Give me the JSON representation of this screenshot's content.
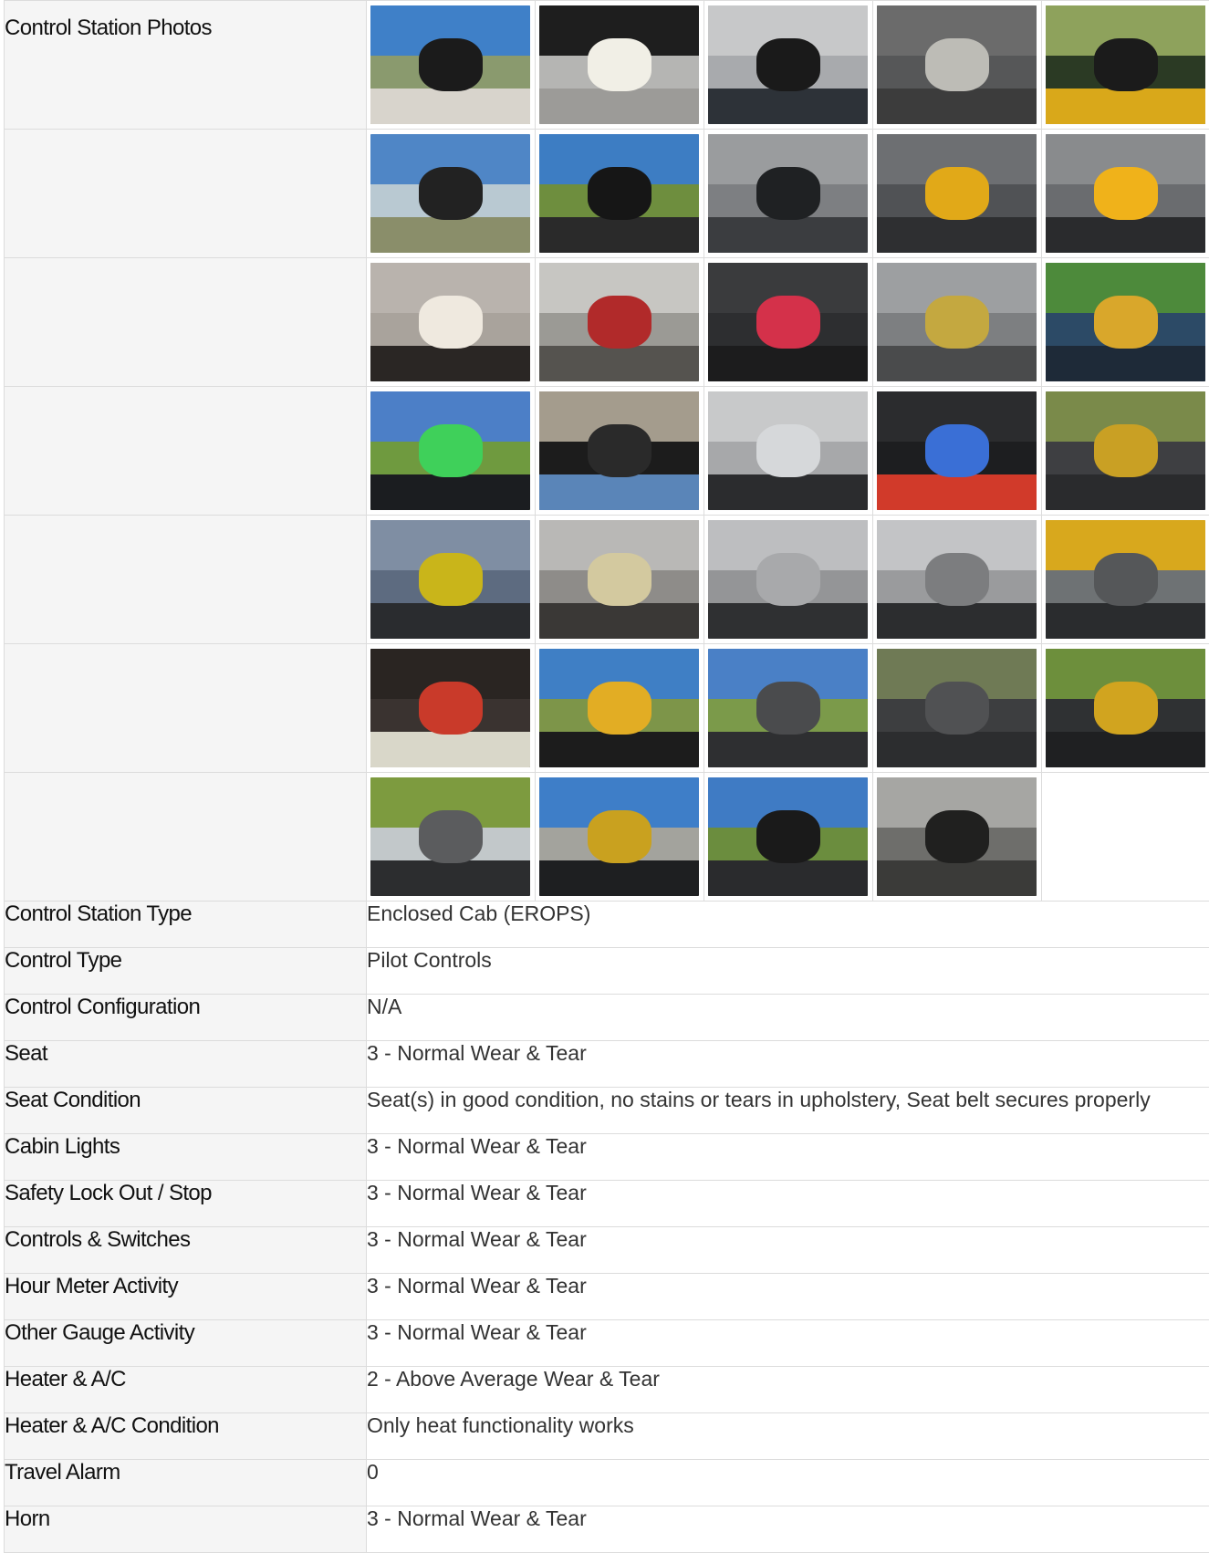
{
  "photos_label": "Control Station Photos",
  "photo_rows": [
    {
      "photos": [
        {
          "name": "photo-door-sticker",
          "c": [
            "#3f80c8",
            "#8a9a6e",
            "#d8d4cc",
            "#1b1b1b"
          ]
        },
        {
          "name": "photo-cab-ceiling-light",
          "c": [
            "#1e1e1e",
            "#b5b5b3",
            "#9c9b98",
            "#f1efe6"
          ]
        },
        {
          "name": "photo-ceiling-vent",
          "c": [
            "#c7c8c9",
            "#a8aaad",
            "#2d3238",
            "#1a1a1a"
          ]
        },
        {
          "name": "photo-ignition-knob",
          "c": [
            "#6b6b6b",
            "#565758",
            "#3c3c3c",
            "#bdbcb6"
          ]
        },
        {
          "name": "photo-engine-hood-view",
          "c": [
            "#8ea25c",
            "#2b3a24",
            "#d9a81a",
            "#1b1b1b"
          ]
        }
      ]
    },
    {
      "photos": [
        {
          "name": "photo-cab-door-open",
          "c": [
            "#4f86c6",
            "#b9c9d2",
            "#8a8e6a",
            "#222222"
          ]
        },
        {
          "name": "photo-cab-rear-window",
          "c": [
            "#3d7dc3",
            "#6e8e3e",
            "#2a2a2a",
            "#161616"
          ]
        },
        {
          "name": "photo-armrest",
          "c": [
            "#9a9c9e",
            "#7d7f82",
            "#3b3d40",
            "#1f2123"
          ]
        },
        {
          "name": "photo-joystick-left",
          "c": [
            "#6d6f72",
            "#505255",
            "#2e2f31",
            "#e1a918"
          ]
        },
        {
          "name": "photo-joystick-right",
          "c": [
            "#898b8d",
            "#6a6c6f",
            "#2a2b2d",
            "#f0b21a"
          ]
        }
      ]
    },
    {
      "photos": [
        {
          "name": "photo-dome-light",
          "c": [
            "#b9b3ad",
            "#a9a39c",
            "#2a2624",
            "#efe9df"
          ]
        },
        {
          "name": "photo-cupholders",
          "c": [
            "#c7c6c2",
            "#9b9a95",
            "#55534f",
            "#b12a2a"
          ]
        },
        {
          "name": "photo-power-outlets",
          "c": [
            "#3a3b3d",
            "#2d2e30",
            "#1c1c1d",
            "#d4314a"
          ]
        },
        {
          "name": "photo-key-switch",
          "c": [
            "#9d9fa1",
            "#7d7f81",
            "#4a4b4c",
            "#c4a840"
          ]
        },
        {
          "name": "photo-switch-keypad",
          "c": [
            "#4d8a3b",
            "#2c4a66",
            "#1e2a38",
            "#d9a72b"
          ]
        }
      ]
    },
    {
      "photos": [
        {
          "name": "photo-side-keypad",
          "c": [
            "#4c7fc7",
            "#6f9a3f",
            "#1b1d20",
            "#3fd05a"
          ]
        },
        {
          "name": "photo-rear-camera-display",
          "c": [
            "#a49c8d",
            "#1c1c1c",
            "#5a85b8",
            "#2a2a2a"
          ]
        },
        {
          "name": "photo-radio",
          "c": [
            "#c8c9ca",
            "#a7a8aa",
            "#2b2c2e",
            "#d6d8da"
          ]
        },
        {
          "name": "photo-climate-knobs",
          "c": [
            "#2b2c2e",
            "#1d1e20",
            "#d13a2a",
            "#3a6fd6"
          ]
        },
        {
          "name": "photo-steering-column",
          "c": [
            "#7a8a4a",
            "#3e3f42",
            "#2a2b2d",
            "#c9a024"
          ]
        }
      ]
    },
    {
      "photos": [
        {
          "name": "photo-defrost-vent",
          "c": [
            "#7f8ea3",
            "#5d6b80",
            "#2a2c2f",
            "#c9b51a"
          ]
        },
        {
          "name": "photo-round-vent-1",
          "c": [
            "#b9b8b6",
            "#8e8c89",
            "#3a3836",
            "#d3c99f"
          ]
        },
        {
          "name": "photo-round-vent-2",
          "c": [
            "#bdbec0",
            "#949597",
            "#2f3032",
            "#a8a9ab"
          ]
        },
        {
          "name": "photo-round-vent-3",
          "c": [
            "#c3c4c6",
            "#9a9b9d",
            "#2c2d2f",
            "#7c7d7f"
          ]
        },
        {
          "name": "photo-dash-vent",
          "c": [
            "#d8a81d",
            "#6e7274",
            "#2a2c2e",
            "#555759"
          ]
        }
      ]
    },
    {
      "photos": [
        {
          "name": "photo-gauge-cluster",
          "c": [
            "#2a2522",
            "#3a3330",
            "#d9d7c9",
            "#c93a2a"
          ]
        },
        {
          "name": "photo-steering-wheel",
          "c": [
            "#3f7fc5",
            "#7d9549",
            "#1c1c1c",
            "#e2ad24"
          ]
        },
        {
          "name": "photo-operator-seat",
          "c": [
            "#4a80c6",
            "#7b9a4a",
            "#2e2f31",
            "#4a4b4d"
          ]
        },
        {
          "name": "photo-seat-cushion",
          "c": [
            "#6f7a55",
            "#3d3e40",
            "#2c2d2f",
            "#505153"
          ]
        },
        {
          "name": "photo-cab-interior",
          "c": [
            "#6d8f3c",
            "#2f3133",
            "#1f2022",
            "#d1a41f"
          ]
        }
      ]
    },
    {
      "photos": [
        {
          "name": "photo-seat-side-view",
          "c": [
            "#7d9b3f",
            "#c2c8ca",
            "#2c2d2f",
            "#5b5c5e"
          ]
        },
        {
          "name": "photo-cab-door-exterior",
          "c": [
            "#3e7ec8",
            "#a3a39d",
            "#1e1f21",
            "#c9a11f"
          ]
        },
        {
          "name": "photo-cab-rear-view",
          "c": [
            "#3f7bc4",
            "#6b8d3e",
            "#2a2b2d",
            "#1a1a1a"
          ]
        },
        {
          "name": "photo-floor-pedals",
          "c": [
            "#a6a6a3",
            "#6e6e6b",
            "#3b3b39",
            "#20201f"
          ]
        }
      ]
    }
  ],
  "fields": [
    {
      "label": "Control Station Type",
      "value": "Enclosed Cab (EROPS)"
    },
    {
      "label": "Control Type",
      "value": "Pilot Controls"
    },
    {
      "label": "Control Configuration",
      "value": "N/A"
    },
    {
      "label": "Seat",
      "value": "3 - Normal Wear & Tear"
    },
    {
      "label": "Seat Condition",
      "value": "Seat(s) in good condition, no stains or tears in upholstery, Seat belt secures properly"
    },
    {
      "label": "Cabin Lights",
      "value": "3 - Normal Wear & Tear"
    },
    {
      "label": "Safety Lock Out / Stop",
      "value": "3 - Normal Wear & Tear"
    },
    {
      "label": "Controls & Switches",
      "value": "3 - Normal Wear & Tear"
    },
    {
      "label": "Hour Meter Activity",
      "value": "3 - Normal Wear & Tear"
    },
    {
      "label": "Other Gauge Activity",
      "value": "3 - Normal Wear & Tear"
    },
    {
      "label": "Heater & A/C",
      "value": "2 - Above Average Wear & Tear"
    },
    {
      "label": "Heater & A/C Condition",
      "value": "Only heat functionality works"
    },
    {
      "label": "Travel Alarm",
      "value": "0"
    },
    {
      "label": "Horn",
      "value": "3 - Normal Wear & Tear"
    }
  ]
}
